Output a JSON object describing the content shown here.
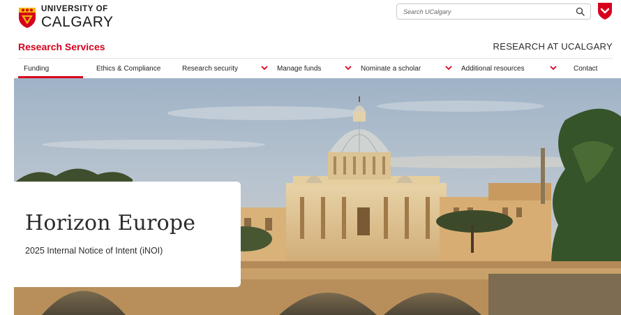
{
  "header": {
    "logo_line1": "UNIVERSITY OF",
    "logo_line2": "CALGARY",
    "search_placeholder": "Search UCalgary",
    "brand_red": "#d6001c"
  },
  "section": {
    "title": "Research Services",
    "research_link": "RESEARCH AT UCALGARY"
  },
  "nav": {
    "items": [
      {
        "label": "Funding",
        "has_dropdown": true,
        "active": true
      },
      {
        "label": "Ethics & Compliance",
        "has_dropdown": false
      },
      {
        "label": "Research security",
        "has_dropdown": true
      },
      {
        "label": "Manage funds",
        "has_dropdown": true
      },
      {
        "label": "Nominate a scholar",
        "has_dropdown": true
      },
      {
        "label": "Additional resources",
        "has_dropdown": true
      },
      {
        "label": "Contact",
        "has_dropdown": false
      }
    ]
  },
  "hero": {
    "title": "Horizon Europe",
    "subtitle": "2025 Internal Notice of Intent (iNOI)"
  },
  "icons": {
    "search": "search-icon",
    "shield": "shield-chevron-icon",
    "crest": "university-crest-icon",
    "chevron": "chevron-down-icon"
  }
}
